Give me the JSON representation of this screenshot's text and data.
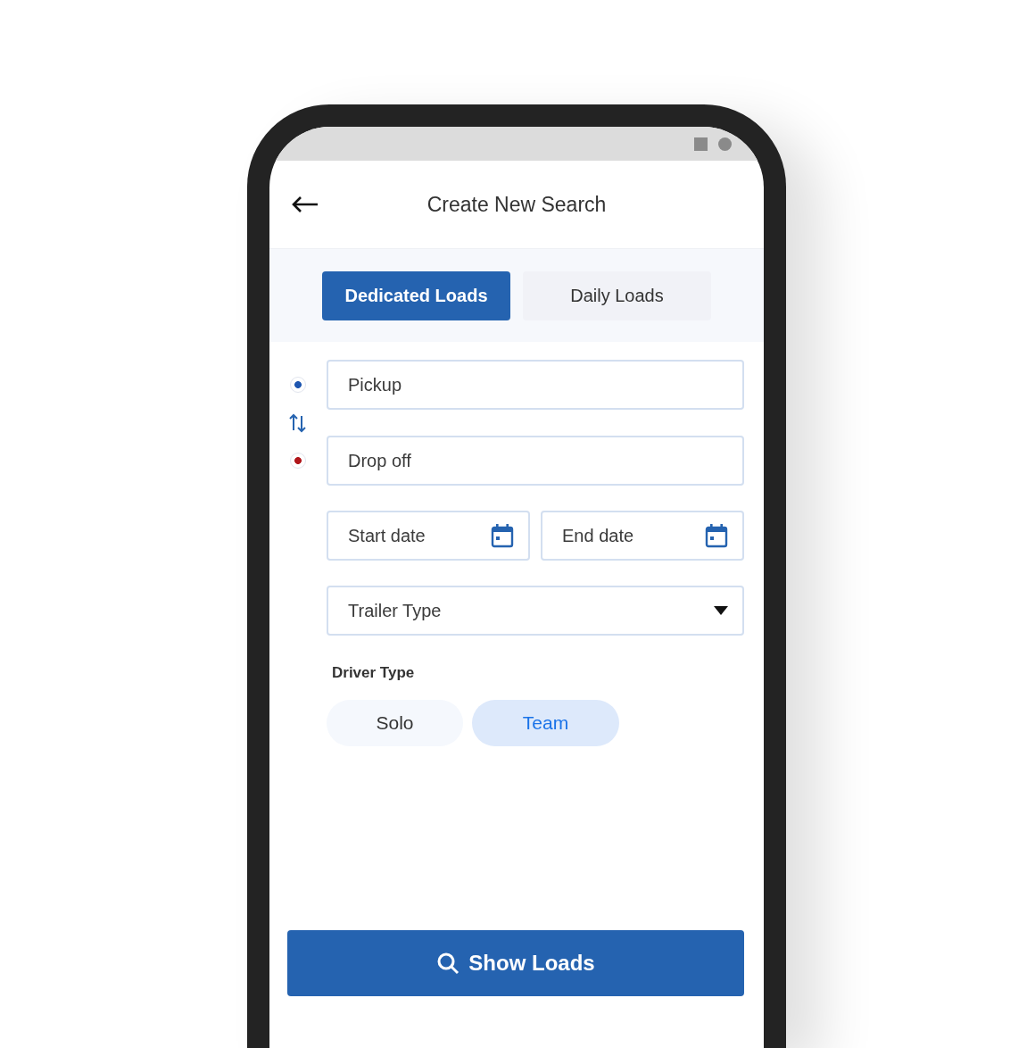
{
  "header": {
    "title": "Create New Search"
  },
  "tabs": [
    {
      "label": "Dedicated Loads",
      "selected": true
    },
    {
      "label": "Daily Loads",
      "selected": false
    }
  ],
  "locations": [
    {
      "placeholder": "Pickup",
      "color": "#1e56b0"
    },
    {
      "placeholder": "Drop off",
      "color": "#b0161b"
    }
  ],
  "dates": [
    {
      "placeholder": "Start date"
    },
    {
      "placeholder": "End date"
    }
  ],
  "trailer_type": {
    "placeholder": "Trailer Type"
  },
  "driver_type": {
    "label": "Driver Type",
    "options": [
      {
        "label": "Solo",
        "selected": false
      },
      {
        "label": "Team",
        "selected": true
      }
    ]
  },
  "submit": {
    "label": "Show Loads"
  }
}
